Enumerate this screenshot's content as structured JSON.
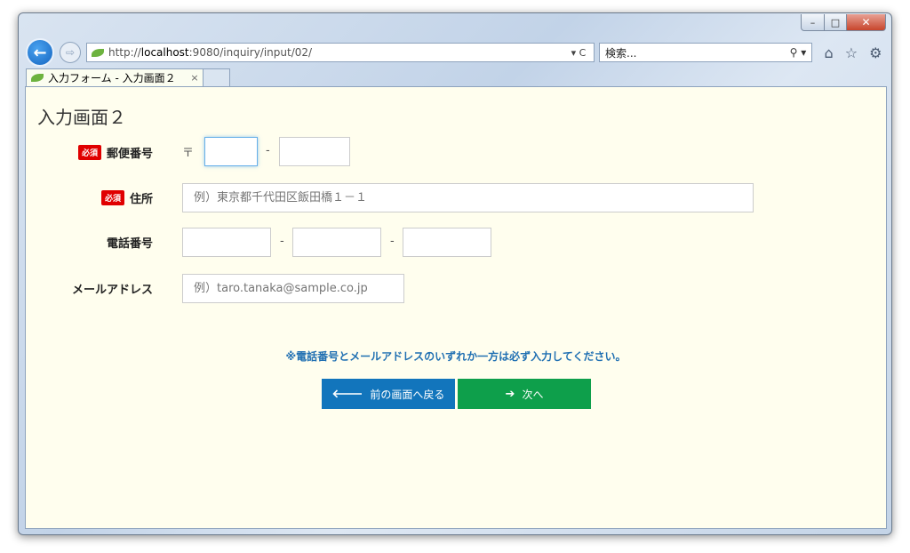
{
  "browser": {
    "url_prefix": "http://",
    "url_host": "localhost",
    "url_rest": ":9080/inquiry/input/02/",
    "url_tools": "▾ C",
    "search_placeholder": "検索...",
    "search_icon": "search-icon",
    "tab_title": "入力フォーム - 入力画面２",
    "tab_close": "×"
  },
  "page": {
    "title": "入力画面２"
  },
  "form": {
    "required_badge": "必須",
    "postal": {
      "label": "郵便番号",
      "mark": "〒",
      "separator": "-"
    },
    "address": {
      "label": "住所",
      "placeholder": "例）東京都千代田区飯田橋１－１"
    },
    "phone": {
      "label": "電話番号",
      "separator": "-"
    },
    "email": {
      "label": "メールアドレス",
      "placeholder": "例）taro.tanaka@sample.co.jp"
    },
    "notice": "※電話番号とメールアドレスのいずれか一方は必ず入力してください。"
  },
  "buttons": {
    "back_label": "前の画面へ戻る",
    "next_label": "次へ"
  },
  "colors": {
    "required": "#e00000",
    "back_button": "#1275bc",
    "next_button": "#0e9f4b",
    "notice": "#1f6fb2",
    "page_background": "#fffeee"
  }
}
